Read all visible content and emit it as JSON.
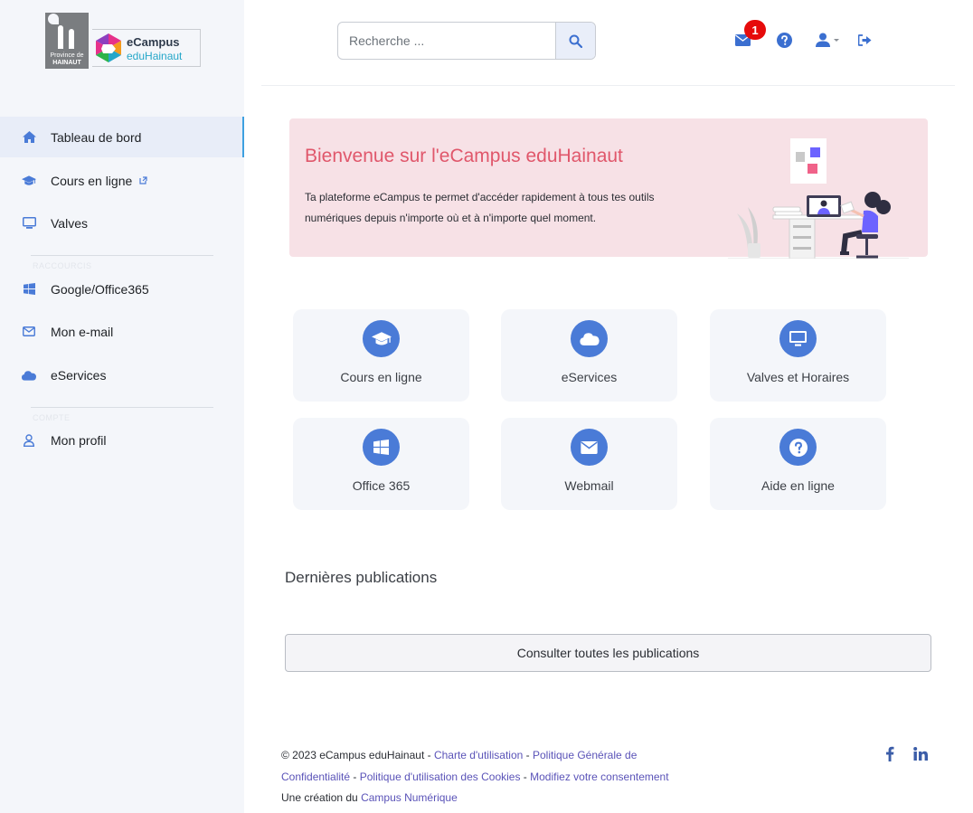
{
  "logo": {
    "province_line1": "Province de",
    "province_line2": "HAINAUT",
    "brand_name": "eCampus",
    "brand_sub": "eduHainaut"
  },
  "sidebar": {
    "items": [
      {
        "label": "Tableau de bord",
        "icon": "home-icon",
        "active": true
      },
      {
        "label": "Cours en ligne",
        "icon": "graduation-cap-icon",
        "external": true
      },
      {
        "label": "Valves",
        "icon": "monitor-icon"
      },
      {
        "label": "Google/Office365",
        "icon": "windows-icon"
      },
      {
        "label": "Mon e-mail",
        "icon": "envelope-icon"
      },
      {
        "label": "eServices",
        "icon": "cloud-icon"
      },
      {
        "label": "Mon profil",
        "icon": "user-icon"
      }
    ],
    "section_labels": [
      "RACCOURCIS",
      "COMPTE"
    ]
  },
  "header": {
    "search_placeholder": "Recherche ...",
    "mail_badge": "1"
  },
  "banner": {
    "title": "Bienvenue sur l'eCampus eduHainaut",
    "text": "Ta plateforme eCampus te permet d'accéder rapidement à tous tes outils numériques depuis n'importe où et à n'importe quel moment."
  },
  "tiles": [
    {
      "label": "Cours en ligne",
      "icon": "graduation-cap-icon"
    },
    {
      "label": "eServices",
      "icon": "cloud-icon"
    },
    {
      "label": "Valves et Horaires",
      "icon": "monitor-icon"
    },
    {
      "label": "Office 365",
      "icon": "windows-icon"
    },
    {
      "label": "Webmail",
      "icon": "envelope-icon"
    },
    {
      "label": "Aide en ligne",
      "icon": "question-icon"
    }
  ],
  "publications": {
    "title": "Dernières publications",
    "button": "Consulter toutes les publications"
  },
  "footer": {
    "copyright": "© 2023 eCampus eduHainaut - ",
    "link_charte": "Charte d'utilisation",
    "sep1": " - ",
    "link_politique": "Politique Générale de Confidentialité",
    "sep2": " - ",
    "link_cookies": "Politique d'utilisation des Cookies",
    "sep3": " - ",
    "link_consent": "Modifiez votre consentement",
    "creation": "Une création du ",
    "link_campus": "Campus Numérique"
  },
  "colors": {
    "accent": "#4a7bd7",
    "banner_bg": "#f7e1e6",
    "banner_title": "#e0576b",
    "sidebar_bg": "#f4f6fa",
    "badge": "#e60b0b",
    "link": "#5a53b8"
  }
}
